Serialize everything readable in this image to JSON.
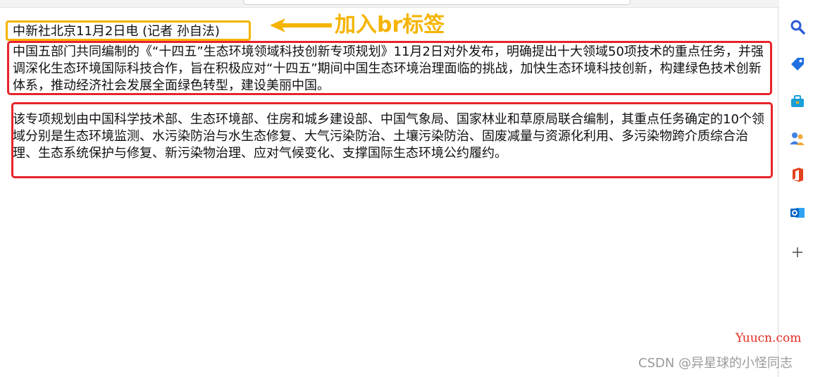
{
  "page": {
    "dateline": "中新社北京11月2日电 (记者 孙自法)",
    "paragraph1": "中国五部门共同编制的《“十四五”生态环境领域科技创新专项规划》11月2日对外发布，明确提出十大领域50项技术的重点任务，并强调深化生态环境国际科技合作，旨在积极应对“十四五”期间中国生态环境治理面临的挑战，加快生态环境科技创新，构建绿色技术创新体系，推动经济社会发展全面绿色转型，建设美丽中国。",
    "paragraph2": "该专项规划由中国科学技术部、生态环境部、住房和城乡建设部、中国气象局、国家林业和草原局联合编制，其重点任务确定的10个领域分别是生态环境监测、水污染防治与水生态修复、大气污染防治、土壤污染防治、固废减量与资源化利用、多污染物跨介质综合治理、生态系统保护与修复、新污染物治理、应对气候变化、支撑国际生态环境公约履约。"
  },
  "annotation": {
    "label": "加入br标签",
    "color": "#f5b400",
    "box_color": "#e8232a"
  },
  "sidebar": {
    "icons": [
      "search-icon",
      "tag-icon",
      "toolbox-icon",
      "people-icon",
      "office-icon",
      "outlook-icon",
      "plus-icon"
    ]
  },
  "watermarks": {
    "site": "Yuucn.com",
    "csdn": "CSDN @异星球的小怪同志"
  }
}
